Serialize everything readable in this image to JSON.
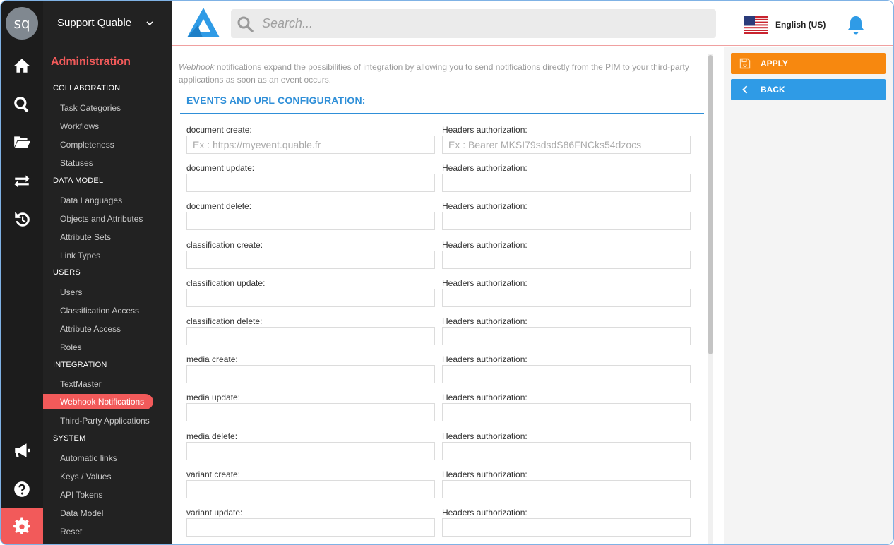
{
  "user": {
    "initials": "sq",
    "account_name": "Support Quable"
  },
  "icons": {
    "rail": [
      "home-icon",
      "search-icon",
      "folder-open-icon",
      "exchange-icon",
      "history-icon",
      "megaphone-icon",
      "help-icon",
      "gear-icon"
    ],
    "header": [
      "logo-icon",
      "search-icon",
      "us-flag-icon",
      "bell-icon"
    ],
    "actions": [
      "save-icon",
      "chevron-left-icon"
    ]
  },
  "sidebar": {
    "title": "Administration",
    "sections": [
      {
        "label": "COLLABORATION",
        "items": [
          "Task Categories",
          "Workflows",
          "Completeness",
          "Statuses"
        ]
      },
      {
        "label": "DATA MODEL",
        "items": [
          "Data Languages",
          "Objects and Attributes",
          "Attribute Sets",
          "Link Types"
        ]
      },
      {
        "label": "USERS",
        "items": [
          "Users",
          "Classification Access",
          "Attribute Access",
          "Roles"
        ]
      },
      {
        "label": "INTEGRATION",
        "items": [
          "TextMaster",
          "Webhook Notifications",
          "Third-Party Applications"
        ]
      },
      {
        "label": "SYSTEM",
        "items": [
          "Automatic links",
          "Keys / Values",
          "API Tokens",
          "Data Model",
          "Reset"
        ]
      }
    ],
    "active_item": "Webhook Notifications"
  },
  "header": {
    "search_placeholder": "Search...",
    "language": "English (US)"
  },
  "main": {
    "intro_lead": "Webhook",
    "intro_rest": " notifications expand the possibilities of integration by allowing you to send notifications directly from the PIM to your third-party applications as soon as an event occurs.",
    "section_title": "EVENTS AND URL CONFIGURATION:",
    "headers_label": "Headers authorization:",
    "url_placeholder": "Ex : https://myevent.quable.fr",
    "headers_placeholder": "Ex : Bearer MKSI79sdsdS86FNCks54dzocs",
    "events": [
      "document create:",
      "document update:",
      "document delete:",
      "classification create:",
      "classification update:",
      "classification delete:",
      "media create:",
      "media update:",
      "media delete:",
      "variant create:",
      "variant update:"
    ]
  },
  "actions": {
    "apply": "APPLY",
    "back": "BACK"
  },
  "colors": {
    "accent": "#f25a5a",
    "apply": "#f7880f",
    "back": "#2f9be6",
    "title_blue": "#2f8fd8",
    "sidebar_bg": "#222222"
  }
}
